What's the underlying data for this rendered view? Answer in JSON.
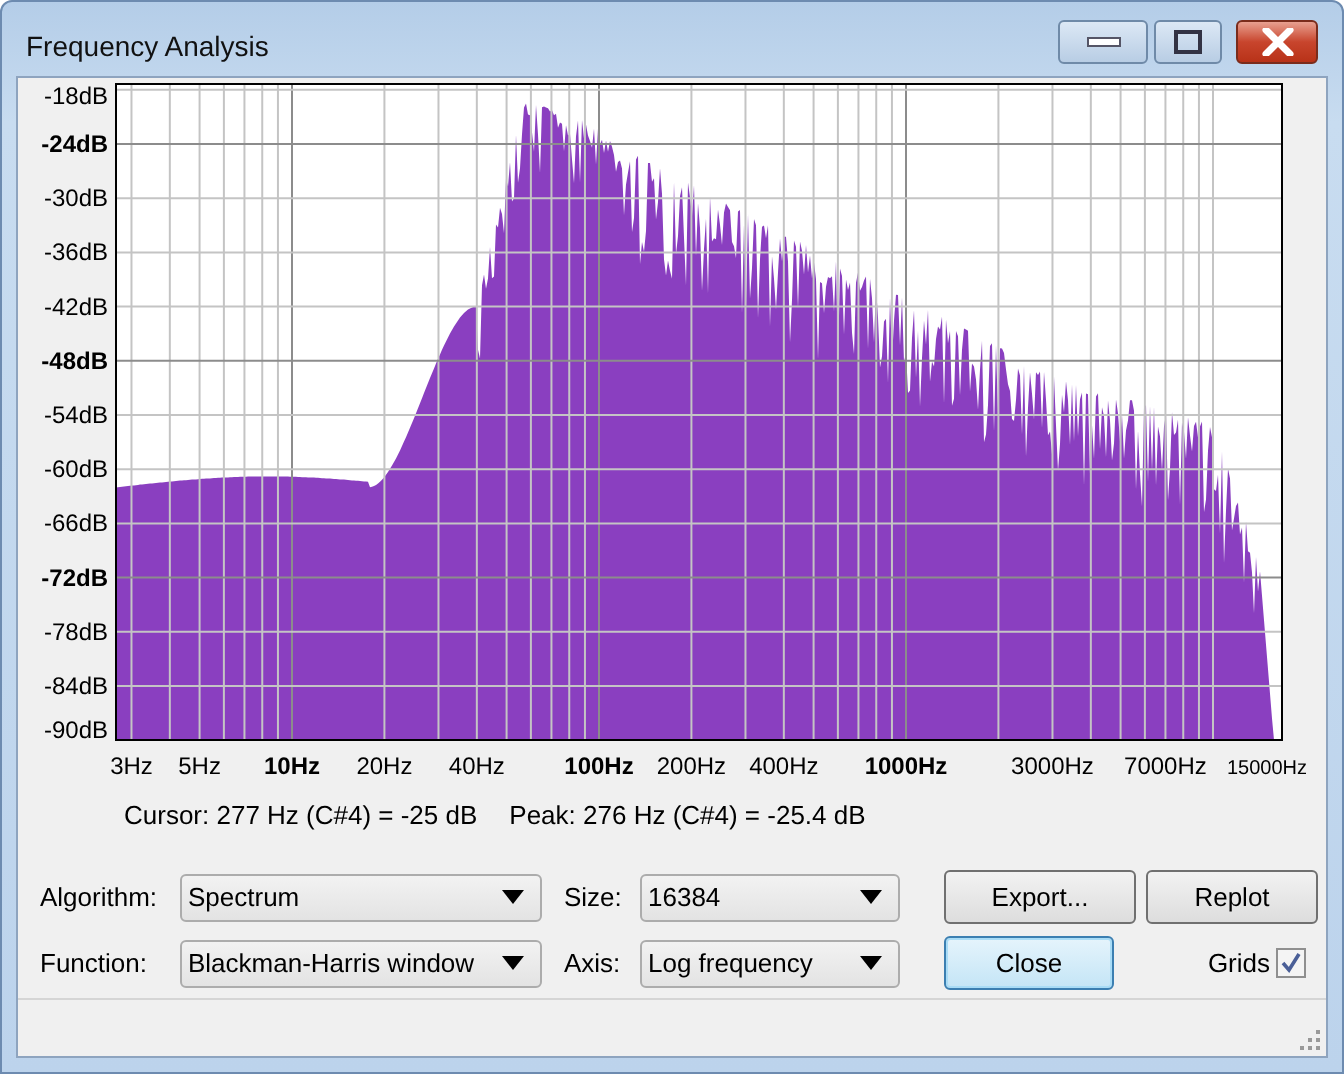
{
  "window": {
    "title": "Frequency Analysis"
  },
  "plot": {
    "y_labels": [
      {
        "text": "-18dB",
        "bold": false
      },
      {
        "text": "-24dB",
        "bold": true
      },
      {
        "text": "-30dB",
        "bold": false
      },
      {
        "text": "-36dB",
        "bold": false
      },
      {
        "text": "-42dB",
        "bold": false
      },
      {
        "text": "-48dB",
        "bold": true
      },
      {
        "text": "-54dB",
        "bold": false
      },
      {
        "text": "-60dB",
        "bold": false
      },
      {
        "text": "-66dB",
        "bold": false
      },
      {
        "text": "-72dB",
        "bold": true
      },
      {
        "text": "-78dB",
        "bold": false
      },
      {
        "text": "-84dB",
        "bold": false
      },
      {
        "text": "-90dB",
        "bold": false
      }
    ],
    "x_labels": [
      {
        "text": "3Hz",
        "bold": false,
        "small": false
      },
      {
        "text": "5Hz",
        "bold": false,
        "small": false
      },
      {
        "text": "10Hz",
        "bold": true,
        "small": false
      },
      {
        "text": "20Hz",
        "bold": false,
        "small": false
      },
      {
        "text": "40Hz",
        "bold": false,
        "small": false
      },
      {
        "text": "100Hz",
        "bold": true,
        "small": false
      },
      {
        "text": "200Hz",
        "bold": false,
        "small": false
      },
      {
        "text": "400Hz",
        "bold": false,
        "small": false
      },
      {
        "text": "1000Hz",
        "bold": true,
        "small": false
      },
      {
        "text": "3000Hz",
        "bold": false,
        "small": false
      },
      {
        "text": "7000Hz",
        "bold": false,
        "small": false
      },
      {
        "text": "15000Hz",
        "bold": false,
        "small": true
      }
    ]
  },
  "readout": {
    "cursor": "Cursor: 277 Hz (C#4) = -25 dB",
    "peak": "Peak: 276 Hz (C#4) = -25.4 dB"
  },
  "controls": {
    "algorithm": {
      "label": "Algorithm:",
      "value": "Spectrum"
    },
    "size": {
      "label": "Size:",
      "value": "16384"
    },
    "function": {
      "label": "Function:",
      "value": "Blackman-Harris window"
    },
    "axis": {
      "label": "Axis:",
      "value": "Log frequency"
    },
    "buttons": [
      {
        "label": "Export...",
        "default": false
      },
      {
        "label": "Replot",
        "default": false
      },
      {
        "label": "Close",
        "default": true
      }
    ],
    "grids": {
      "label": "Grids",
      "checked": true
    }
  }
}
